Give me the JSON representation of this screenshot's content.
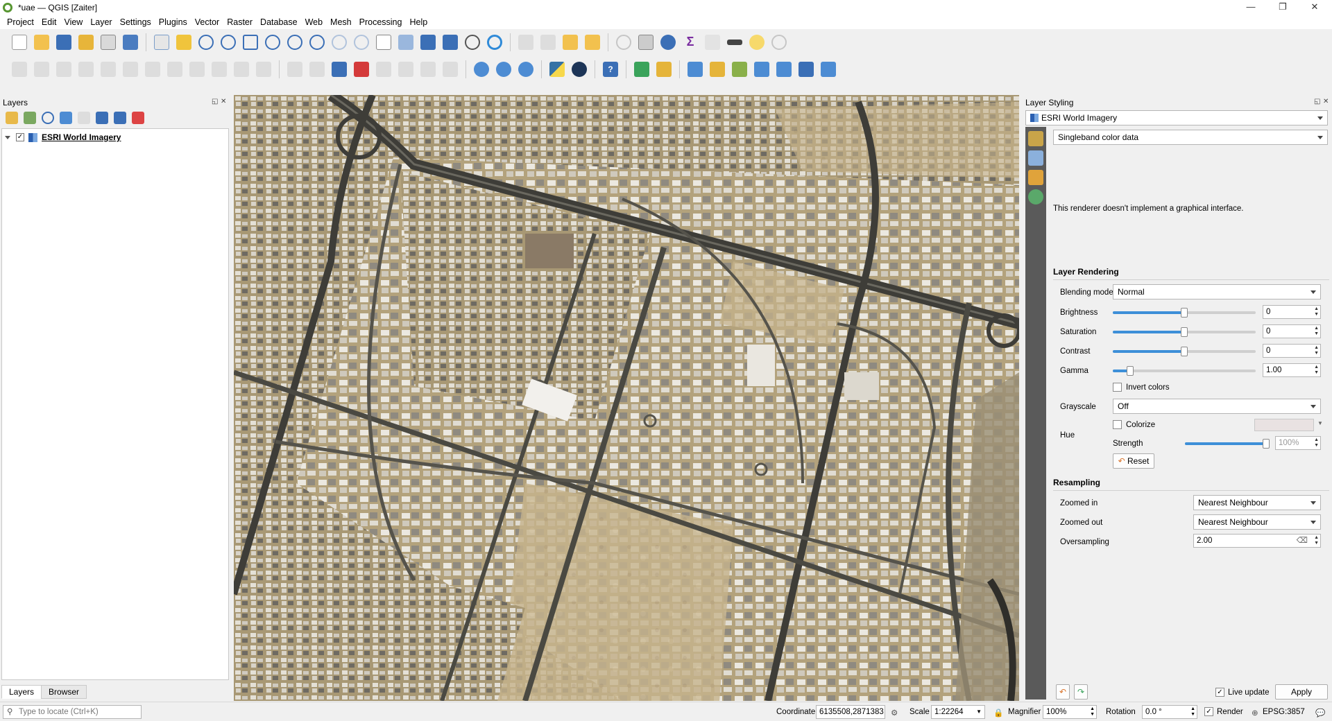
{
  "window": {
    "title": "*uae — QGIS [Zaiter]",
    "minimize": "—",
    "restore": "❐",
    "close": "✕"
  },
  "menu": [
    "Project",
    "Edit",
    "View",
    "Layer",
    "Settings",
    "Plugins",
    "Vector",
    "Raster",
    "Database",
    "Web",
    "Mesh",
    "Processing",
    "Help"
  ],
  "layers_panel": {
    "title": "Layers",
    "layer_name": "ESRI World Imagery",
    "check": "✓",
    "tabs": [
      "Layers",
      "Browser"
    ]
  },
  "styling_panel": {
    "title": "Layer Styling",
    "layer_select": "ESRI World Imagery",
    "renderer_select": "Singleband color data",
    "message": "This renderer doesn't implement a graphical interface.",
    "layer_rendering": {
      "header": "Layer Rendering",
      "blending_label": "Blending mode",
      "blending_value": "Normal",
      "brightness_label": "Brightness",
      "brightness_value": "0",
      "brightness_level": 0.5,
      "saturation_label": "Saturation",
      "saturation_value": "0",
      "saturation_level": 0.5,
      "contrast_label": "Contrast",
      "contrast_value": "0",
      "contrast_level": 0.5,
      "gamma_label": "Gamma",
      "gamma_value": "1.00",
      "gamma_level": 0.12,
      "invert_label": "Invert colors",
      "grayscale_label": "Grayscale",
      "grayscale_value": "Off",
      "hue_label": "Hue",
      "colorize_label": "Colorize",
      "strength_label": "Strength",
      "strength_value": "100%",
      "strength_level": 1.0,
      "reset_label": "Reset"
    },
    "resampling": {
      "header": "Resampling",
      "zoomed_in_label": "Zoomed in",
      "zoomed_in_value": "Nearest Neighbour",
      "zoomed_out_label": "Zoomed out",
      "zoomed_out_value": "Nearest Neighbour",
      "oversampling_label": "Oversampling",
      "oversampling_value": "2.00"
    },
    "live_update_label": "Live update",
    "apply_label": "Apply"
  },
  "statusbar": {
    "locator_placeholder": "Type to locate (Ctrl+K)",
    "coordinate_label": "Coordinate",
    "coordinate_value": "6135508,2871383",
    "scale_label": "Scale",
    "scale_value": "1:22264",
    "magnifier_label": "Magnifier",
    "magnifier_value": "100%",
    "rotation_label": "Rotation",
    "rotation_value": "0.0 °",
    "render_label": "Render",
    "crs_label": "EPSG:3857"
  }
}
